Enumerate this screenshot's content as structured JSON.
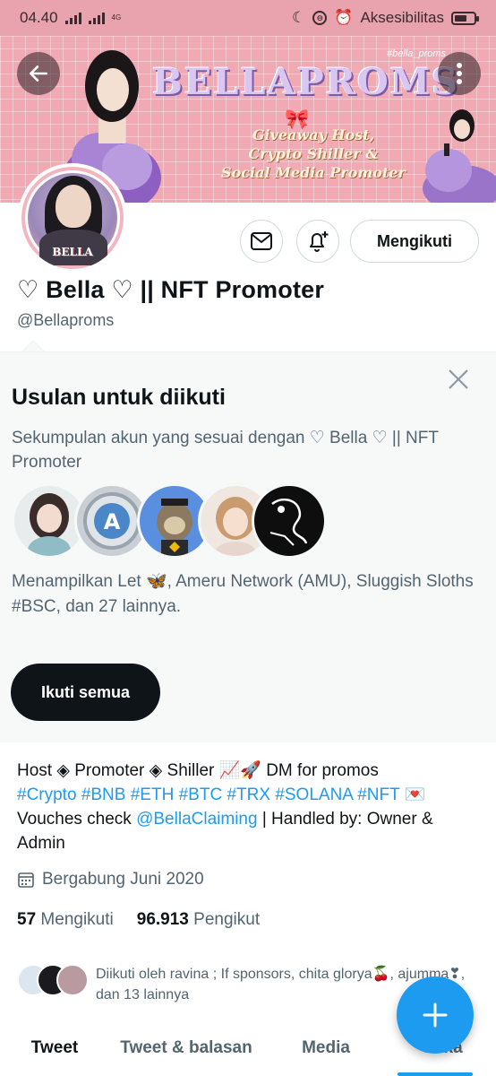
{
  "status_bar": {
    "time": "04.40",
    "network": "4G",
    "accessibility": "Aksesibilitas",
    "battery_level": 0.55
  },
  "banner": {
    "title": "BELLAPROMS",
    "handle": "#bella_proms",
    "tagline": [
      "Giveaway Host,",
      "Crypto Shiller &",
      "Social Media Promoter"
    ]
  },
  "avatar": {
    "label": "BELLA"
  },
  "actions": {
    "follow_label": "Mengikuti",
    "mail_icon": "mail-icon",
    "notify_icon": "bell-plus-icon"
  },
  "profile": {
    "display_name": "♡ Bella ♡ || NFT Promoter",
    "handle": "@Bellaproms"
  },
  "suggestions": {
    "title": "Usulan untuk diikuti",
    "subtitle": "Sekumpulan akun yang sesuai dengan ♡ Bella ♡ || NFT Promoter",
    "names": "Menampilkan Let 🦋, Ameru Network (AMU), Sluggish Sloths #BSC, dan 27 lainnya.",
    "follow_all_label": "Ikuti semua"
  },
  "bio": {
    "line1": "Host ◈ Promoter ◈ Shiller 📈🚀 DM for promos",
    "tags": [
      "#Crypto",
      "#BNB",
      "#ETH",
      "#BTC",
      "#TRX",
      "#SOLANA",
      "#NFT"
    ],
    "tags_suffix": "💌",
    "vouch_prefix": "Vouches check ",
    "vouch_handle": "@BellaClaiming",
    "vouch_suffix": " | Handled by: Owner & Admin"
  },
  "joined": "Bergabung Juni 2020",
  "stats": {
    "following_count": "57",
    "following_label": "Mengikuti",
    "followers_count": "96.913",
    "followers_label": "Pengikut"
  },
  "followed_by": "Diikuti oleh ravina ; If sponsors, chita glorya🍒, ajumma❣, dan 13 lainnya",
  "tabs": [
    "Tweet",
    "Tweet & balasan",
    "Media",
    "Suka"
  ],
  "colors": {
    "accent": "#1d9bf0",
    "banner_pink": "#f1a9b4",
    "status_bar": "#e8a3ae"
  }
}
